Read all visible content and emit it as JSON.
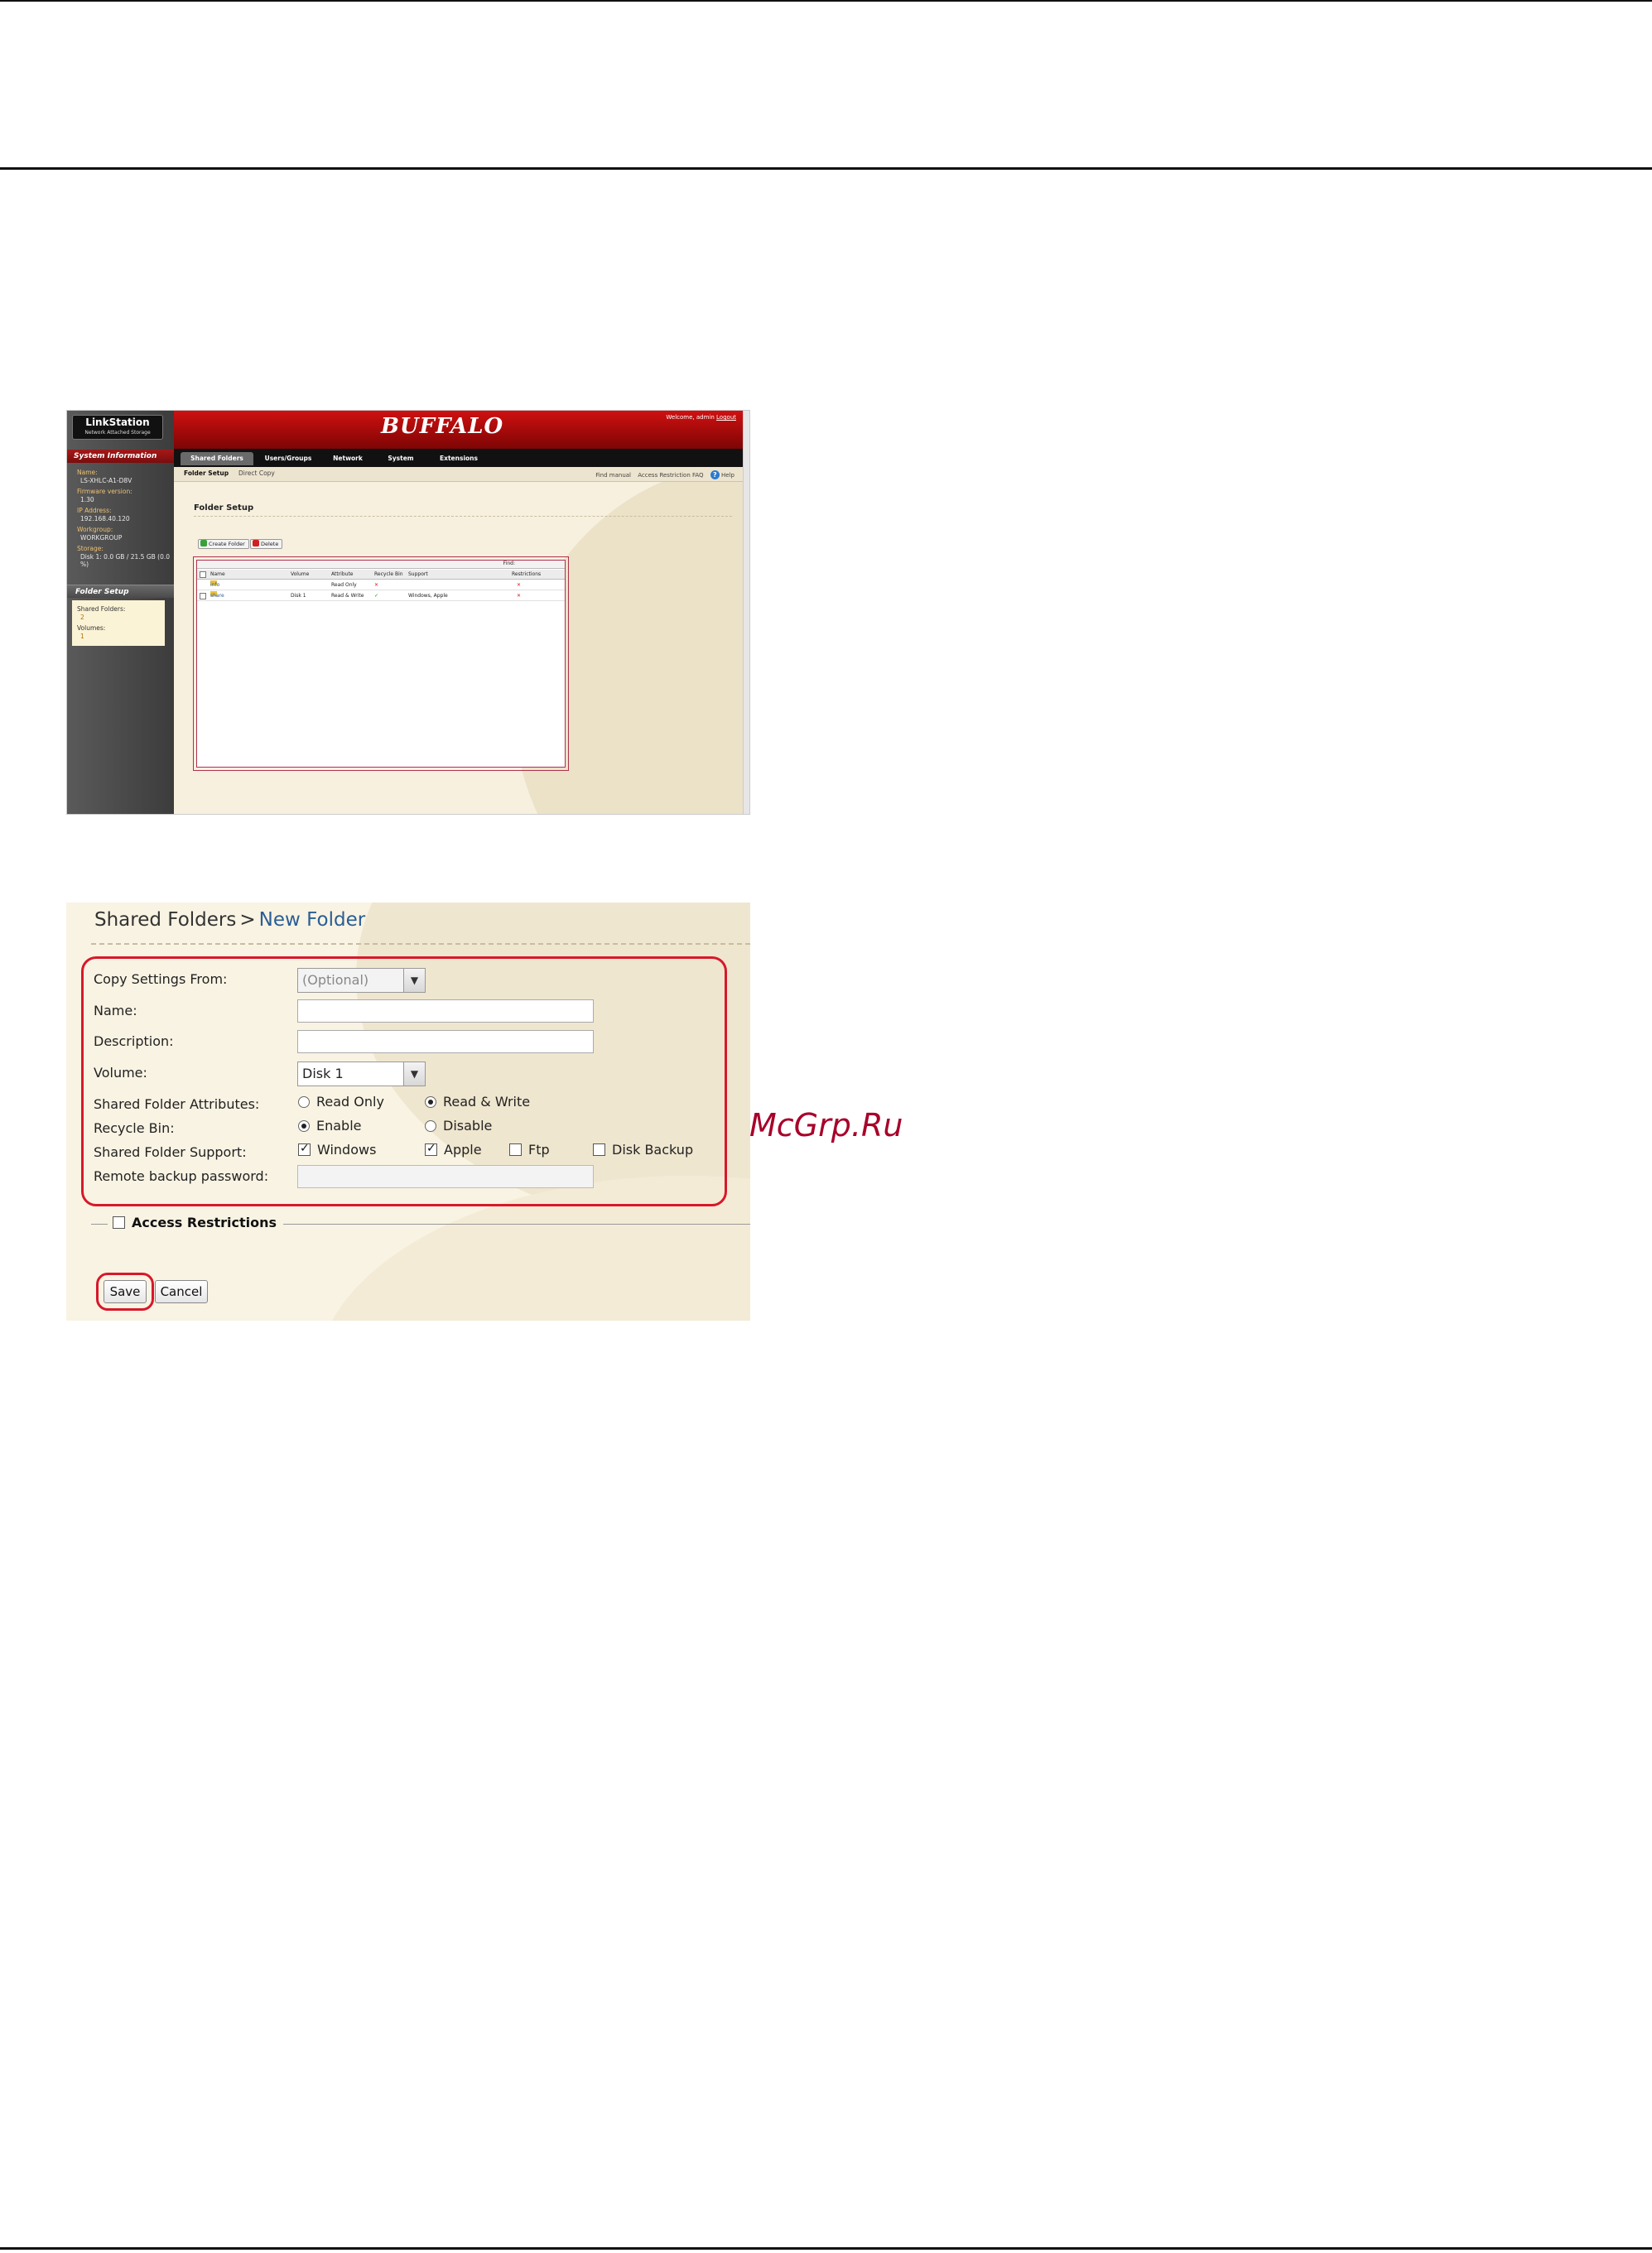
{
  "screenshot1": {
    "logo_title": "LinkStation",
    "logo_subtitle": "Network Attached Storage",
    "brand": "BUFFALO",
    "welcome_prefix": "Welcome, admin",
    "logout": "Logout",
    "system_info_heading": "System Information",
    "sysinfo": [
      {
        "key": "Name:",
        "value": "LS-XHLC-A1-D8V"
      },
      {
        "key": "Firmware version:",
        "value": "1.30"
      },
      {
        "key": "IP Address:",
        "value": "192.168.40.120"
      },
      {
        "key": "Workgroup:",
        "value": "WORKGROUP"
      },
      {
        "key": "Storage:",
        "value": "Disk 1: 0.0 GB / 21.5 GB (0.0 %)"
      }
    ],
    "folder_setup_heading": "Folder Setup",
    "shared_folders_label": "Shared Folders:",
    "shared_folders_count": "2",
    "volumes_label": "Volumes:",
    "volumes_count": "1",
    "tabs": [
      "Shared Folders",
      "Users/Groups",
      "Network",
      "System",
      "Extensions"
    ],
    "subtabs": [
      "Folder Setup",
      "Direct Copy"
    ],
    "help_links": [
      "Find manual",
      "Access Restriction FAQ",
      "Help"
    ],
    "page_title": "Folder Setup",
    "create_button": "Create Folder",
    "delete_button": "Delete",
    "find_label": "Find:",
    "columns": [
      "Name",
      "Volume",
      "Attribute",
      "Recycle Bin",
      "Support",
      "Restrictions"
    ],
    "rows": [
      {
        "name": "info",
        "volume": "",
        "attribute": "Read Only",
        "support": ""
      },
      {
        "name": "share",
        "volume": "Disk 1",
        "attribute": "Read & Write",
        "support": "Windows, Apple"
      }
    ]
  },
  "screenshot2": {
    "breadcrumb_root": "Shared Folders",
    "breadcrumb_sep": ">",
    "breadcrumb_current": "New Folder",
    "labels": {
      "copy_settings": "Copy Settings From:",
      "name": "Name:",
      "description": "Description:",
      "volume": "Volume:",
      "attributes": "Shared Folder Attributes:",
      "recycle": "Recycle Bin:",
      "support": "Shared Folder Support:",
      "remote_pw": "Remote backup password:"
    },
    "copy_settings_placeholder": "(Optional)",
    "volume_value": "Disk 1",
    "attr_options": [
      "Read Only",
      "Read & Write"
    ],
    "recycle_options": [
      "Enable",
      "Disable"
    ],
    "support_options": [
      "Windows",
      "Apple",
      "Ftp",
      "Disk Backup"
    ],
    "access_restrictions": "Access Restrictions",
    "save_button": "Save",
    "cancel_button": "Cancel"
  },
  "watermark": "McGrp.Ru",
  "colors": {
    "highlight": "#d8182b",
    "brand_red": "#c00a0a",
    "link_blue": "#2a5e95"
  }
}
